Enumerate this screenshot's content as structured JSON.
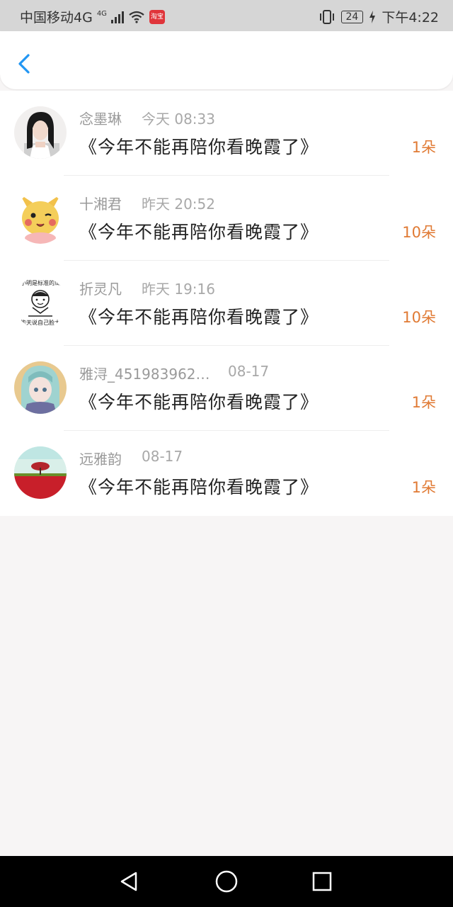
{
  "status_bar": {
    "carrier": "中国移动4G",
    "network_badge": "4G",
    "app_badge": "淘宝",
    "battery": "24",
    "time": "下午4:22",
    "icons": [
      "signal-icon",
      "wifi-icon",
      "vibrate-icon",
      "battery-icon",
      "charging-icon"
    ]
  },
  "header": {
    "back_icon": "chevron-left-icon",
    "accent": "#2196f3"
  },
  "list": [
    {
      "name": "念墨琳",
      "time": "今天 08:33",
      "title": "《今年不能再陪你看晚霞了》",
      "count": "1朵"
    },
    {
      "name": "十湘君",
      "time": "昨天 20:52",
      "title": "《今年不能再陪你看晚霞了》",
      "count": "10朵"
    },
    {
      "name": "折灵凡",
      "time": "昨天 19:16",
      "title": "《今年不能再陪你看晚霞了》",
      "count": "10朵"
    },
    {
      "name": "雅浔_451983962…",
      "time": "08-17",
      "title": "《今年不能再陪你看晚霞了》",
      "count": "1朵"
    },
    {
      "name": "远雅韵",
      "time": "08-17",
      "title": "《今年不能再陪你看晚霞了》",
      "count": "1朵"
    }
  ],
  "avatar_memes": {
    "top": "小明是标准的瓜",
    "bottom": "能天说自己脸大"
  },
  "colors": {
    "count": "#e07a34",
    "name": "#9a9a9a",
    "title": "#222222"
  },
  "nav": {
    "icons": [
      "back-triangle-icon",
      "home-circle-icon",
      "recents-square-icon"
    ]
  }
}
